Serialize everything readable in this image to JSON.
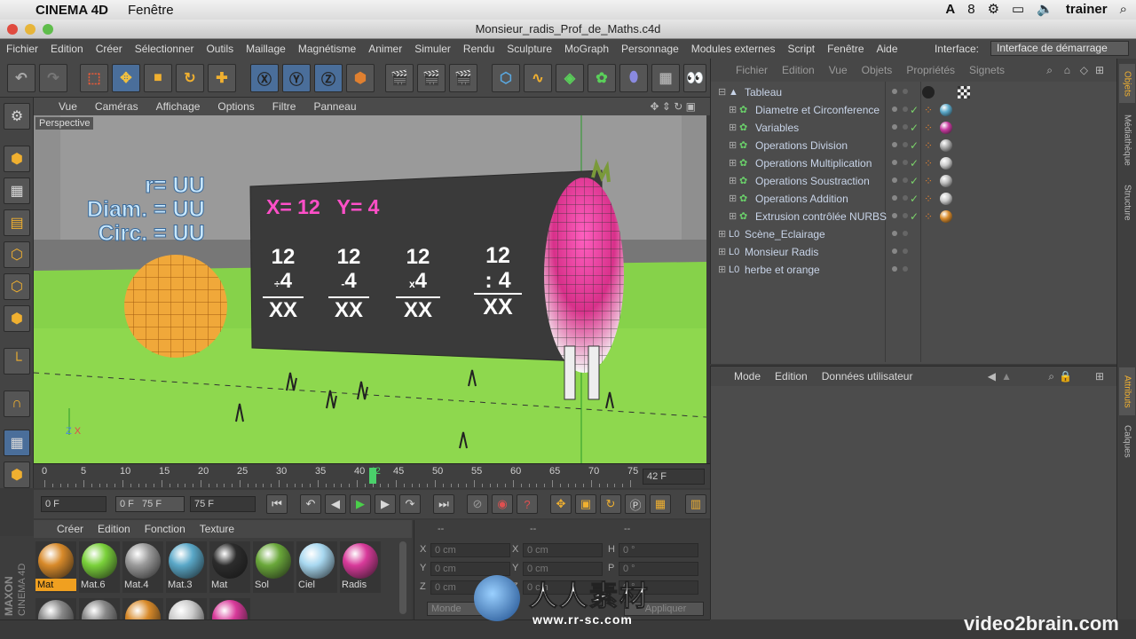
{
  "mac_menubar": {
    "app_name": "CINEMA 4D",
    "menu": "Fenêtre",
    "status_num": "8",
    "user": "trainer"
  },
  "window": {
    "title": "Monsieur_radis_Prof_de_Maths.c4d"
  },
  "app_menu": {
    "items": [
      "Fichier",
      "Edition",
      "Créer",
      "Sélectionner",
      "Outils",
      "Maillage",
      "Magnétisme",
      "Animer",
      "Simuler",
      "Rendu",
      "Sculpture",
      "MoGraph",
      "Personnage",
      "Modules externes",
      "Script",
      "Fenêtre",
      "Aide"
    ],
    "interface_label": "Interface:",
    "interface_value": "Interface de démarrage"
  },
  "viewport": {
    "menu": [
      "Vue",
      "Caméras",
      "Affichage",
      "Options",
      "Filtre",
      "Panneau"
    ],
    "label": "Perspective",
    "board_lines": [
      "r= UU",
      "Diam. = UU",
      "Circ. = UU"
    ],
    "xy": "X= 12   Y= 4",
    "ops": [
      {
        "top": "12",
        "sign": "÷",
        "bottom": "4",
        "result": "XX"
      },
      {
        "top": "12",
        "sign": "-",
        "bottom": "4",
        "result": "XX"
      },
      {
        "top": "12",
        "sign": "x",
        "bottom": "4",
        "result": "XX"
      },
      {
        "top": "12",
        "sign": ":",
        "bottom": "4",
        "result": "XX"
      }
    ],
    "axis_z": "Z",
    "axis_x": "X"
  },
  "timeline": {
    "ticks": [
      "0",
      "5",
      "10",
      "15",
      "20",
      "25",
      "30",
      "35",
      "40",
      "42",
      "45",
      "50",
      "55",
      "60",
      "65",
      "70",
      "75"
    ],
    "current_frame": 42,
    "frame_display": "42 F"
  },
  "transport": {
    "start": "0 F",
    "range": "0 F   75 F",
    "end": "75 F"
  },
  "materials": {
    "menu": [
      "Créer",
      "Edition",
      "Fonction",
      "Texture"
    ],
    "items": [
      {
        "label": "Mat",
        "color": "#d88a2a",
        "selected": true
      },
      {
        "label": "Mat.6",
        "color": "#7ad13a",
        "selected": false
      },
      {
        "label": "Mat.4",
        "color": "#9a9a9a",
        "selected": false
      },
      {
        "label": "Mat.3",
        "color": "#5aa8c8",
        "selected": false
      },
      {
        "label": "Mat",
        "color": "#2c2c2c",
        "selected": false
      },
      {
        "label": "Sol",
        "color": "#6aa83a",
        "selected": false
      },
      {
        "label": "Ciel",
        "color": "#a8d8f0",
        "selected": false
      },
      {
        "label": "Radis",
        "color": "#d83a9a",
        "selected": false
      }
    ]
  },
  "coords": {
    "headers": [
      "--",
      "--",
      "--"
    ],
    "rows": [
      {
        "a": "X",
        "av": "0 cm",
        "b": "X",
        "bv": "0 cm",
        "c": "H",
        "cv": "0 °"
      },
      {
        "a": "Y",
        "av": "0 cm",
        "b": "Y",
        "bv": "0 cm",
        "c": "P",
        "cv": "0 °"
      },
      {
        "a": "Z",
        "av": "0 cm",
        "b": "Z",
        "bv": "0 cm",
        "c": "B",
        "cv": "0 °"
      }
    ],
    "mode": "Monde",
    "apply": "Appliquer"
  },
  "objects": {
    "menu": [
      "Fichier",
      "Edition",
      "Vue",
      "Objets",
      "Propriétés",
      "Signets"
    ],
    "rows": [
      {
        "name": "Tableau",
        "level": 0,
        "checked": false
      },
      {
        "name": "Diametre et Circonference",
        "level": 1,
        "checked": true
      },
      {
        "name": "Variables",
        "level": 1,
        "checked": true
      },
      {
        "name": "Operations Division",
        "level": 1,
        "checked": true
      },
      {
        "name": "Operations Multiplication",
        "level": 1,
        "checked": true
      },
      {
        "name": "Operations Soustraction",
        "level": 1,
        "checked": true
      },
      {
        "name": "Operations Addition",
        "level": 1,
        "checked": true
      },
      {
        "name": "Extrusion contrôlée NURBS",
        "level": 1,
        "checked": true
      },
      {
        "name": "Scène_Eclairage",
        "level": 0,
        "checked": false
      },
      {
        "name": "Monsieur Radis",
        "level": 0,
        "checked": false
      },
      {
        "name": "herbe et orange",
        "level": 0,
        "checked": false
      }
    ]
  },
  "attributes": {
    "menu": [
      "Mode",
      "Edition",
      "Données utilisateur"
    ]
  },
  "right_tabs": [
    "Objets",
    "Médiathèque",
    "Structure",
    "Attributs",
    "Calques"
  ],
  "watermark": {
    "brand": "video2brain.com",
    "cjk": "人人素材",
    "url": "www.rr-sc.com"
  }
}
